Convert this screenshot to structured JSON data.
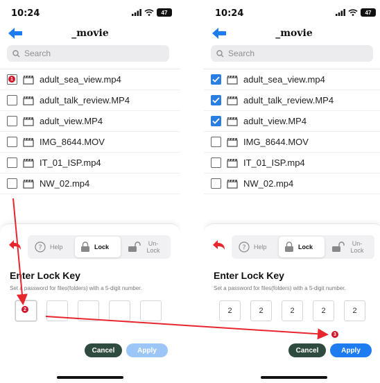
{
  "status": {
    "time": "10:24",
    "battery": "47"
  },
  "nav": {
    "title": "_movie"
  },
  "search": {
    "placeholder": "Search"
  },
  "files": [
    "adult_sea_view.mp4",
    "adult_talk_review.MP4",
    "adult_view.MP4",
    "IMG_8644.MOV",
    "IT_01_ISP.mp4",
    "NW_02.mp4"
  ],
  "left_panel": {
    "checked": [
      false,
      false,
      false,
      false,
      false,
      false
    ],
    "digits": [
      "",
      "",
      "",
      "",
      ""
    ],
    "apply_enabled": false
  },
  "right_panel": {
    "checked": [
      true,
      true,
      true,
      false,
      false,
      false
    ],
    "digits": [
      "2",
      "2",
      "2",
      "2",
      "2"
    ],
    "apply_enabled": true
  },
  "lock_sheet": {
    "help_label": "Help",
    "lock_label": "Lock",
    "unlock_label": "Un-\nLock",
    "title": "Enter Lock Key",
    "hint": "Set a password for files(folders) with a 5-digit number.",
    "cancel_label": "Cancel",
    "apply_label": "Apply"
  },
  "annotations": {
    "step1": "1",
    "step2": "2",
    "step3": "3",
    "color": "#e8262d"
  },
  "colors": {
    "accent": "#1e7cf0",
    "cancel": "#2f4a3f",
    "apply_disabled": "#9cc6f7"
  }
}
